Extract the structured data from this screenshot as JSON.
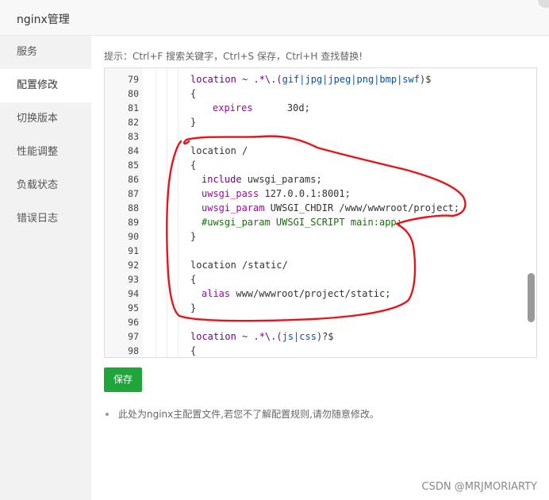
{
  "header": {
    "title": "nginx管理"
  },
  "sidebar": {
    "items": [
      {
        "label": "服务"
      },
      {
        "label": "配置修改",
        "active": true
      },
      {
        "label": "切换版本"
      },
      {
        "label": "性能调整"
      },
      {
        "label": "负载状态"
      },
      {
        "label": "错误日志"
      }
    ]
  },
  "hint": "提示：Ctrl+F 搜索关键字，Ctrl+S 保存，Ctrl+H 查找替换!",
  "editor": {
    "lines": [
      {
        "n": "79",
        "indent": 0,
        "tokens": [
          [
            "location ~ .*\\.(",
            "kw"
          ],
          [
            "gif|jpg|jpeg|png|bmp|swf",
            "str"
          ],
          [
            ")$",
            ""
          ]
        ]
      },
      {
        "n": "80",
        "indent": 0,
        "tokens": [
          [
            "{",
            ""
          ]
        ]
      },
      {
        "n": "81",
        "indent": 2,
        "tokens": [
          [
            "expires",
            "pink"
          ],
          [
            "      30d;",
            ""
          ]
        ]
      },
      {
        "n": "82",
        "indent": 0,
        "tokens": [
          [
            "}",
            ""
          ]
        ]
      },
      {
        "n": "83",
        "indent": 0,
        "tokens": []
      },
      {
        "n": "84",
        "indent": 0,
        "tokens": [
          [
            "location /",
            ""
          ]
        ]
      },
      {
        "n": "85",
        "indent": 0,
        "tokens": [
          [
            "{",
            ""
          ]
        ]
      },
      {
        "n": "86",
        "indent": 1,
        "tokens": [
          [
            "include",
            "kw"
          ],
          [
            " uwsgi_params;",
            ""
          ]
        ]
      },
      {
        "n": "87",
        "indent": 1,
        "tokens": [
          [
            "uwsgi_pass",
            "pink"
          ],
          [
            " 127.0.0.1:8001;",
            ""
          ]
        ]
      },
      {
        "n": "88",
        "indent": 1,
        "tokens": [
          [
            "uwsgi_param",
            "pink"
          ],
          [
            " UWSGI_CHDIR /www/wwwroot/project;",
            ""
          ]
        ]
      },
      {
        "n": "89",
        "indent": 1,
        "tokens": [
          [
            "#uwsgi_param UWSGI_SCRIPT main:app;",
            "grn"
          ]
        ]
      },
      {
        "n": "90",
        "indent": 0,
        "tokens": [
          [
            "}",
            ""
          ]
        ]
      },
      {
        "n": "91",
        "indent": 0,
        "tokens": []
      },
      {
        "n": "92",
        "indent": 0,
        "tokens": [
          [
            "location /static/",
            ""
          ]
        ]
      },
      {
        "n": "93",
        "indent": 0,
        "tokens": [
          [
            "{",
            ""
          ]
        ]
      },
      {
        "n": "94",
        "indent": 1,
        "tokens": [
          [
            "alias",
            "pink"
          ],
          [
            " www/wwwroot/project/static;",
            ""
          ]
        ]
      },
      {
        "n": "95",
        "indent": 0,
        "tokens": [
          [
            "}",
            ""
          ]
        ]
      },
      {
        "n": "96",
        "indent": 0,
        "tokens": []
      },
      {
        "n": "97",
        "indent": 0,
        "tokens": [
          [
            "location ~ .*\\.(",
            "kw"
          ],
          [
            "js|css",
            "str"
          ],
          [
            ")?$",
            ""
          ]
        ]
      },
      {
        "n": "98",
        "indent": 0,
        "tokens": [
          [
            "{",
            ""
          ]
        ]
      }
    ]
  },
  "save_label": "保存",
  "note": "此处为nginx主配置文件,若您不了解配置规则,请勿随意修改。",
  "watermark": "CSDN @MRJMORIARTY",
  "colors": {
    "accent": "#20a53a",
    "annotation": "#e8141b"
  }
}
